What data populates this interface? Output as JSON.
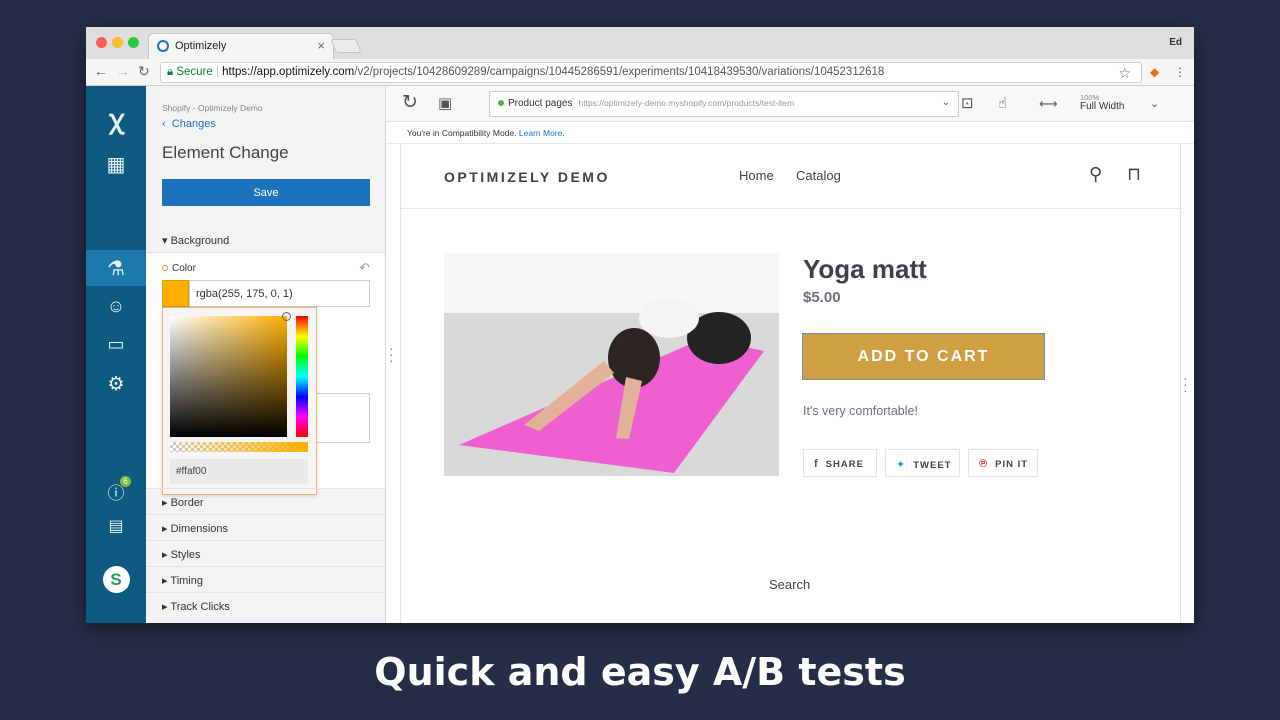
{
  "browser": {
    "tab_title": "Optimizely",
    "tab_close": "×",
    "profile": "Ed",
    "secure_label": "Secure",
    "url_host": "https://app.optimizely.com",
    "url_path": "/v2/projects/10428609289/campaigns/10445286591/experiments/10418439530/variations/10452312618"
  },
  "editor": {
    "breadcrumb": "Shopify - Optimizely Demo",
    "back_label": "Changes",
    "title": "Element Change",
    "save_label": "Save",
    "background_section": "Background",
    "color_label": "Color",
    "color_value": "rgba(255, 175, 0, 1)",
    "color_swatch": "#ffaf00",
    "hex_value": "#ffaf00",
    "sections": [
      "Border",
      "Dimensions",
      "Styles",
      "Timing",
      "Track Clicks"
    ],
    "help_badge": "6"
  },
  "preview_toolbar": {
    "page_label": "Product pages",
    "page_url": "https://optimizely-demo.myshopify.com/products/test-item",
    "zoom_percent": "100%",
    "zoom_mode": "Full Width"
  },
  "compat": {
    "text": "You're in Compatibility Mode.",
    "link": "Learn More."
  },
  "store": {
    "logo": "OPTIMIZELY DEMO",
    "nav": [
      "Home",
      "Catalog"
    ],
    "product_title": "Yoga matt",
    "price": "$5.00",
    "add_to_cart": "ADD TO CART",
    "description": "It's very comfortable!",
    "share": [
      "SHARE",
      "TWEET",
      "PIN IT"
    ],
    "search_label": "Search"
  },
  "caption": "Quick and easy A/B tests",
  "colors": {
    "rail": "#0f5a80",
    "accent": "#1c72bd",
    "cart_button": "#cf9f43",
    "page_bg": "#262d47"
  }
}
